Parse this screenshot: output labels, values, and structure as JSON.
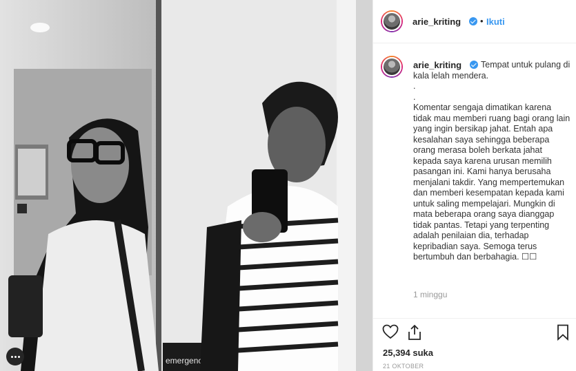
{
  "post": {
    "author": {
      "username": "arie_kriting",
      "verified": true,
      "separator": "•",
      "follow_label": "Ikuti"
    },
    "caption": {
      "username": "arie_kriting",
      "lines": [
        "Tempat untuk pulang di kala lelah mendera.",
        ".",
        ".",
        "Komentar sengaja dimatikan karena tidak mau memberi ruang bagi orang lain yang ingin bersikap jahat. Entah apa kesalahan saya sehingga beberapa orang merasa boleh berkata jahat kepada saya karena urusan memilih pasangan ini. Kami hanya berusaha menjalani takdir. Yang mempertemukan dan memberi kesempatan kepada kami untuk saling mempelajari. Mungkin di mata beberapa orang saya dianggap tidak pantas. Tetapi yang terpenting adalah penilaian dia, terhadap kepribadian saya. Semoga terus bertumbuh dan berbahagia. ☐☐"
      ]
    },
    "relative_time": "1 minggu",
    "likes": "25,394 suka",
    "date": "21 OKTOBER",
    "actions": {
      "like_icon": "heart-icon",
      "share_icon": "share-icon",
      "save_icon": "bookmark-icon"
    },
    "photo": {
      "sign_text": "emergency Exit",
      "more_icon": "more-dots-icon"
    },
    "colors": {
      "link": "#3897f0",
      "text": "#262626",
      "muted": "#999999",
      "border": "#efefef"
    }
  }
}
